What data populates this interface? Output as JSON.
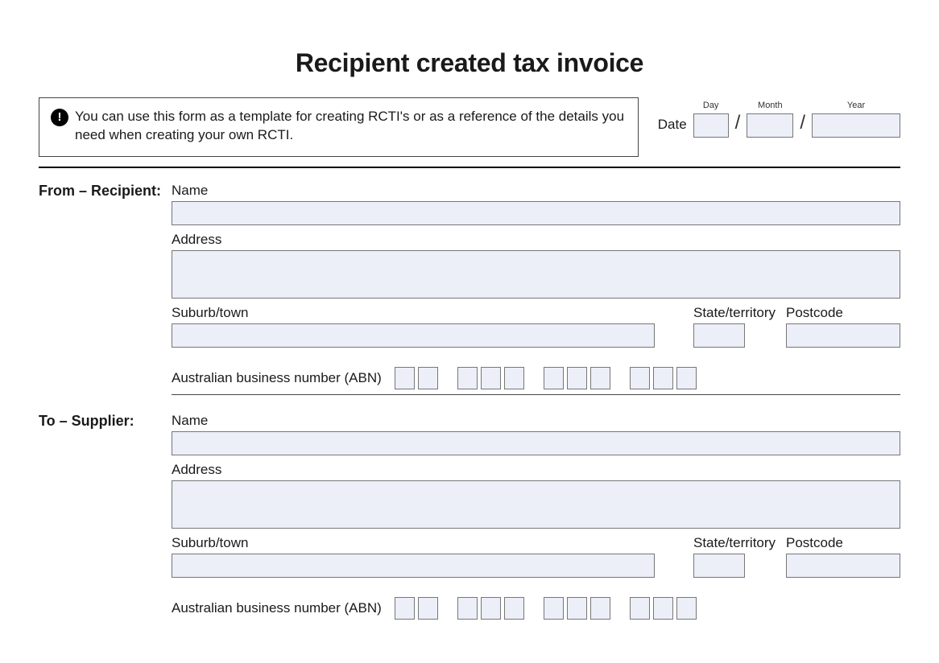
{
  "title": "Recipient created tax invoice",
  "notice": "You can use this form as a template for creating RCTI's or as a reference of the details you need when creating your own RCTI.",
  "date": {
    "label": "Date",
    "day_caption": "Day",
    "month_caption": "Month",
    "year_caption": "Year",
    "day": "",
    "month": "",
    "year": ""
  },
  "recipient": {
    "section_label": "From – Recipient:",
    "name_label": "Name",
    "name": "",
    "address_label": "Address",
    "address": "",
    "suburb_label": "Suburb/town",
    "suburb": "",
    "state_label": "State/territory",
    "state": "",
    "postcode_label": "Postcode",
    "postcode": "",
    "abn_label": "Australian business number (ABN)",
    "abn": [
      "",
      "",
      "",
      "",
      "",
      "",
      "",
      "",
      "",
      "",
      ""
    ]
  },
  "supplier": {
    "section_label": "To – Supplier:",
    "name_label": "Name",
    "name": "",
    "address_label": "Address",
    "address": "",
    "suburb_label": "Suburb/town",
    "suburb": "",
    "state_label": "State/territory",
    "state": "",
    "postcode_label": "Postcode",
    "postcode": "",
    "abn_label": "Australian business number (ABN)",
    "abn": [
      "",
      "",
      "",
      "",
      "",
      "",
      "",
      "",
      "",
      "",
      ""
    ]
  }
}
